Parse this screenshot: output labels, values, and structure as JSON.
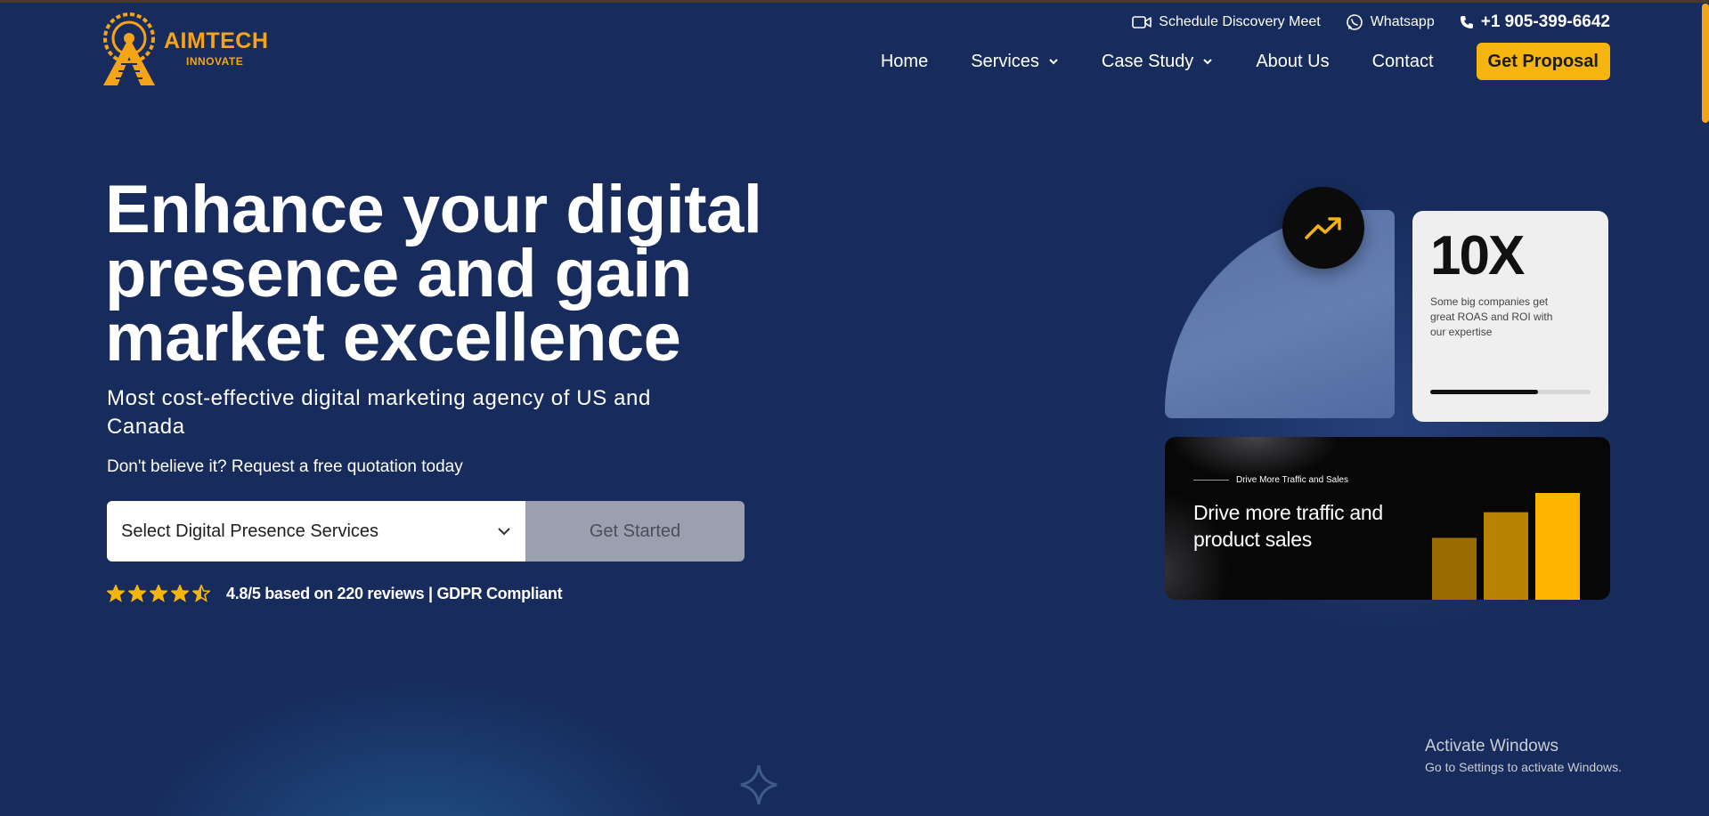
{
  "brand": {
    "name": "AIMTECH",
    "tagline": "INNOVATE",
    "accent": "#f6a417"
  },
  "topbar": {
    "schedule": "Schedule Discovery Meet",
    "whatsapp": "Whatsapp",
    "phone": "+1 905-399-6642"
  },
  "nav": {
    "home": "Home",
    "services": "Services",
    "case_study": "Case Study",
    "about": "About Us",
    "contact": "Contact",
    "proposal": "Get Proposal"
  },
  "hero": {
    "title": "Enhance your digital presence and gain market excellence",
    "subtitle": "Most cost-effective digital marketing agency of US and Canada",
    "note": "Don't believe it? Request a free quotation today",
    "select_value": "Select Digital Presence Services",
    "cta": "Get Started",
    "rating": {
      "value": 4.5,
      "max": 5
    },
    "rating_text": "4.8/5 based on 220 reviews | GDPR Compliant"
  },
  "stat_card": {
    "value": "10X",
    "description": "Some big companies get great ROAS and ROI with our expertise",
    "progress": 0.67
  },
  "promo_card": {
    "eyebrow": "Drive More Traffic and Sales",
    "heading": "Drive more traffic and product sales",
    "bar_levels": [
      0.58,
      0.82,
      1.0
    ],
    "bar_colors": [
      "#9a6c00",
      "#b88300",
      "#ffb400"
    ]
  },
  "system": {
    "activate_title": "Activate Windows",
    "activate_sub": "Go to Settings to activate Windows."
  }
}
